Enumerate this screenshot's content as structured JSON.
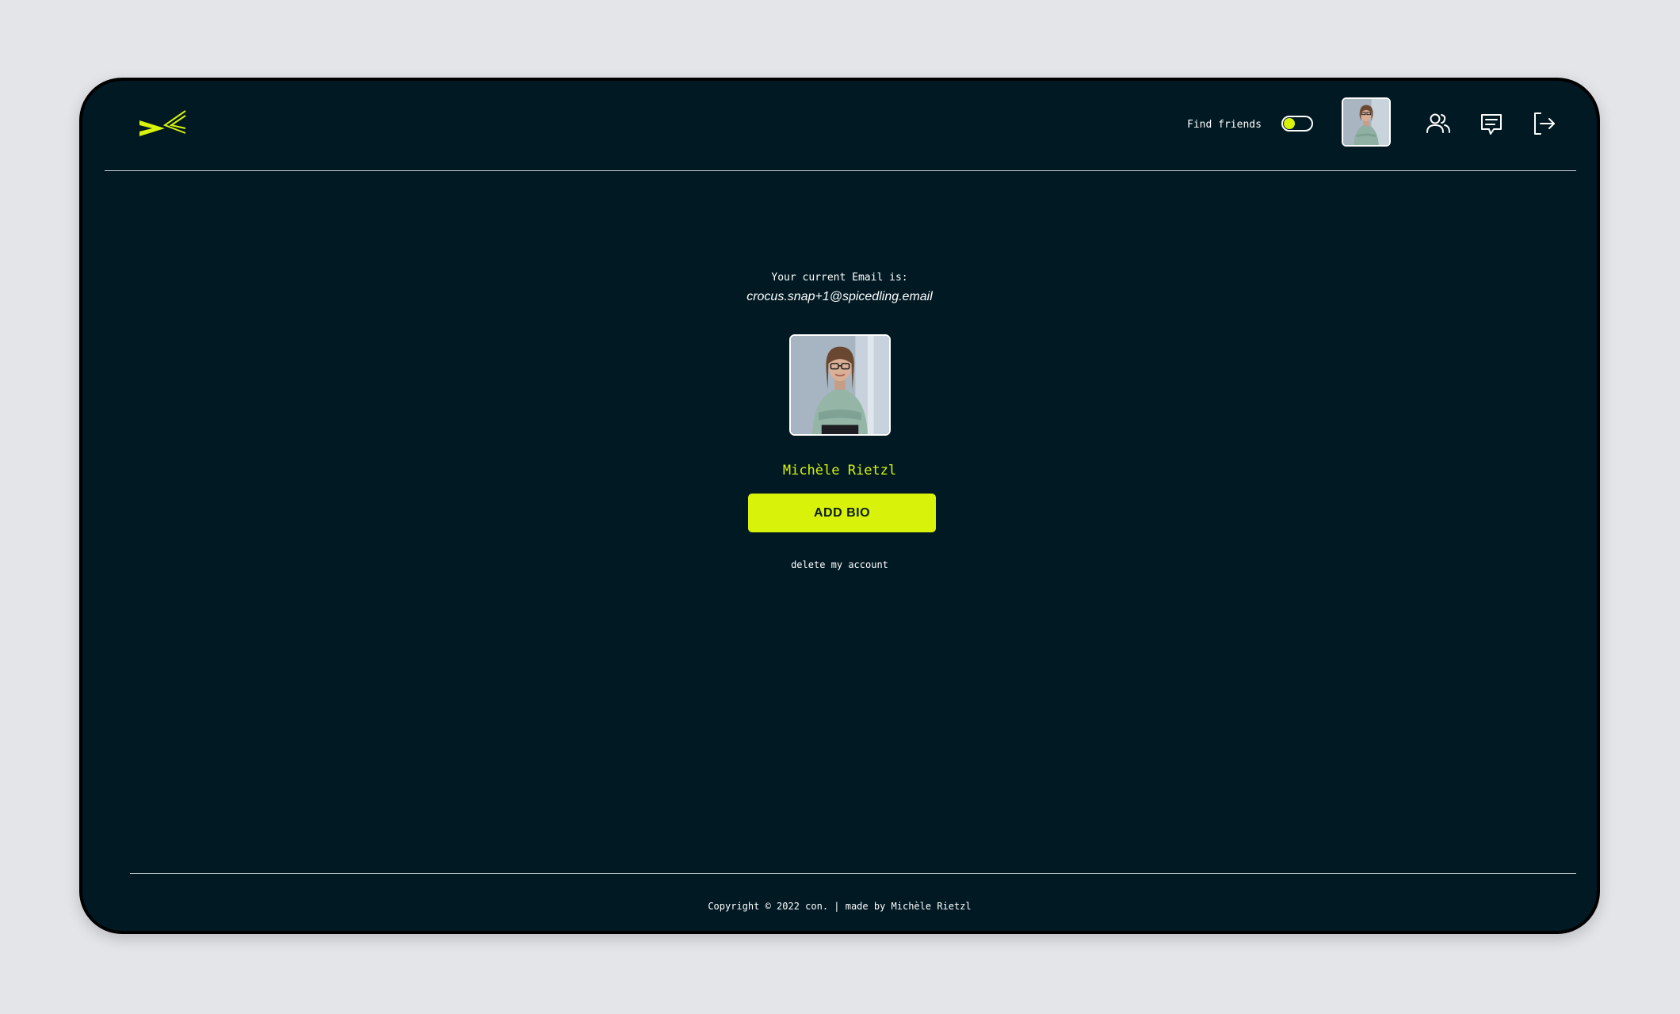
{
  "colors": {
    "page_background": "#e3e5e9",
    "app_background": "#011923",
    "accent": "#d8f20a",
    "text": "#ffffff",
    "divider": "#c9d0d4"
  },
  "header": {
    "logo_icon": "con-logo-icon",
    "find_friends_label": "Find friends",
    "toggle_state": "off",
    "nav_icons": [
      "avatar",
      "friends-icon",
      "chat-icon",
      "logout-icon"
    ]
  },
  "profile": {
    "email_label": "Your current Email is:",
    "email": "crocus.snap+1@spicedling.email",
    "name": "Michèle Rietzl",
    "add_bio_label": "ADD BIO",
    "delete_label": "delete my account"
  },
  "footer": {
    "copyright": "Copyright © 2022 con. | made by Michèle Rietzl"
  }
}
